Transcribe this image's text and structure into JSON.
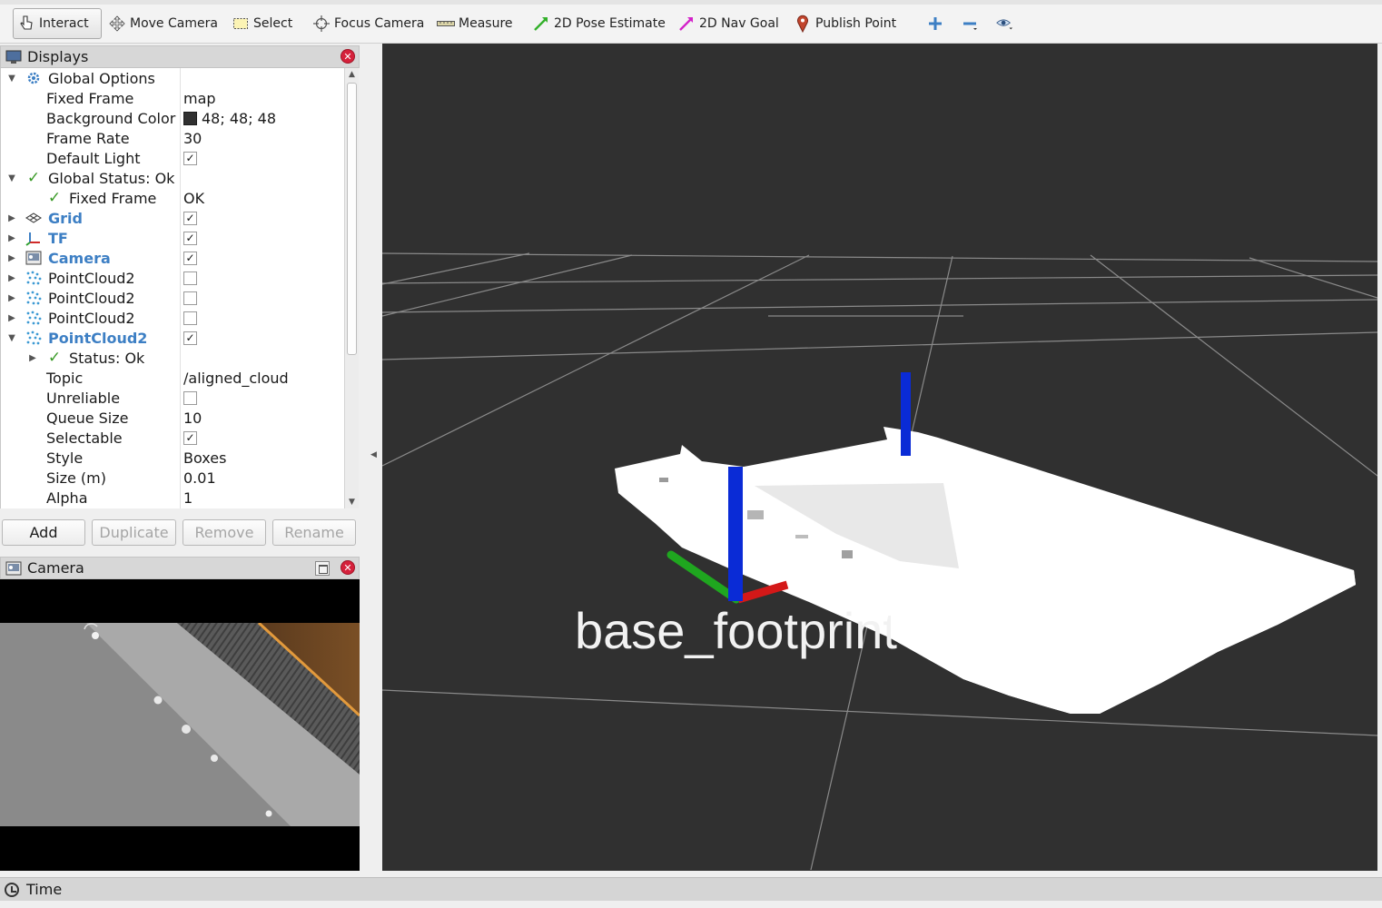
{
  "toolbar": {
    "tools": [
      {
        "label": "Interact",
        "icon": "hand-pointer-icon"
      },
      {
        "label": "Move Camera",
        "icon": "move-arrows-icon"
      },
      {
        "label": "Select",
        "icon": "select-rectangle-icon"
      },
      {
        "label": "Focus Camera",
        "icon": "focus-target-icon"
      },
      {
        "label": "Measure",
        "icon": "ruler-icon"
      },
      {
        "label": "2D Pose Estimate",
        "icon": "green-arrow-icon"
      },
      {
        "label": "2D Nav Goal",
        "icon": "magenta-arrow-icon"
      },
      {
        "label": "Publish Point",
        "icon": "map-pin-icon"
      }
    ],
    "extra_icons": [
      "plus-icon",
      "minus-icon",
      "eye-icon"
    ]
  },
  "displays": {
    "title": "Displays",
    "rows": [
      {
        "name": "Global Options",
        "value": ""
      },
      {
        "name": "Fixed Frame",
        "value": "map"
      },
      {
        "name": "Background Color",
        "value": "48; 48; 48"
      },
      {
        "name": "Frame Rate",
        "value": "30"
      },
      {
        "name": "Default Light",
        "value": ""
      },
      {
        "name": "Global Status: Ok",
        "value": ""
      },
      {
        "name": "Fixed Frame",
        "value": "OK"
      },
      {
        "name": "Grid",
        "value": ""
      },
      {
        "name": "TF",
        "value": ""
      },
      {
        "name": "Camera",
        "value": ""
      },
      {
        "name": "PointCloud2",
        "value": ""
      },
      {
        "name": "PointCloud2",
        "value": ""
      },
      {
        "name": "PointCloud2",
        "value": ""
      },
      {
        "name": "PointCloud2",
        "value": ""
      },
      {
        "name": "Status: Ok",
        "value": ""
      },
      {
        "name": "Topic",
        "value": "/aligned_cloud"
      },
      {
        "name": "Unreliable",
        "value": ""
      },
      {
        "name": "Queue Size",
        "value": "10"
      },
      {
        "name": "Selectable",
        "value": ""
      },
      {
        "name": "Style",
        "value": "Boxes"
      },
      {
        "name": "Size (m)",
        "value": "0.01"
      },
      {
        "name": "Alpha",
        "value": "1"
      }
    ],
    "checkboxes": {
      "default_light": true,
      "grid": true,
      "tf": true,
      "camera": true,
      "pointcloud2_1": false,
      "pointcloud2_2": false,
      "pointcloud2_3": false,
      "pointcloud2_4": true,
      "unreliable": false,
      "selectable": true
    },
    "buttons": {
      "add": "Add",
      "duplicate": "Duplicate",
      "remove": "Remove",
      "rename": "Rename"
    }
  },
  "camera_panel": {
    "title": "Camera"
  },
  "view3d": {
    "frame_label": "base_footprint"
  },
  "timebar": {
    "title": "Time"
  },
  "colors": {
    "background": "#303030",
    "accent_blue": "#3d7fc4",
    "ok_green": "#3a9a27",
    "close_red": "#d5213b"
  }
}
